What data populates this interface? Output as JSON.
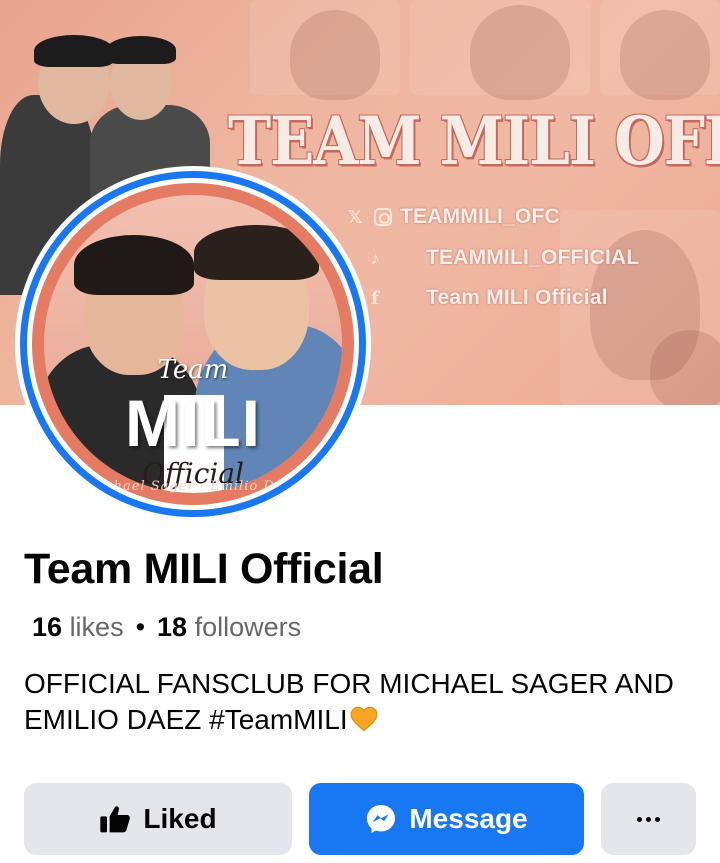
{
  "cover": {
    "title": "TEAM MILI OFFICIAL",
    "socials": [
      {
        "icon": "x-instagram-icons",
        "handle": "TEAMMILI_OFC"
      },
      {
        "icon": "tiktok-icon",
        "handle": "TEAMMILI_OFFICIAL"
      },
      {
        "icon": "facebook-icon",
        "handle": "Team MILI Official"
      }
    ]
  },
  "avatar": {
    "team": "Team",
    "mili": "MILI",
    "official": "Official",
    "names": "Michael Sager · Emilio Daez"
  },
  "profile": {
    "name": "Team MILI Official",
    "likes_count": "16",
    "likes_label": "likes",
    "followers_count": "18",
    "followers_label": "followers",
    "bio": "OFFICIAL FANSCLUB FOR MICHAEL SAGER AND EMILIO DAEZ #TeamMILI"
  },
  "actions": {
    "liked_label": "Liked",
    "message_label": "Message",
    "more_label": "more options"
  },
  "colors": {
    "accent": "#1877f2",
    "cover": "#eeb59f",
    "avatar_ring": "#e57b62",
    "heart": "#f5a623"
  }
}
